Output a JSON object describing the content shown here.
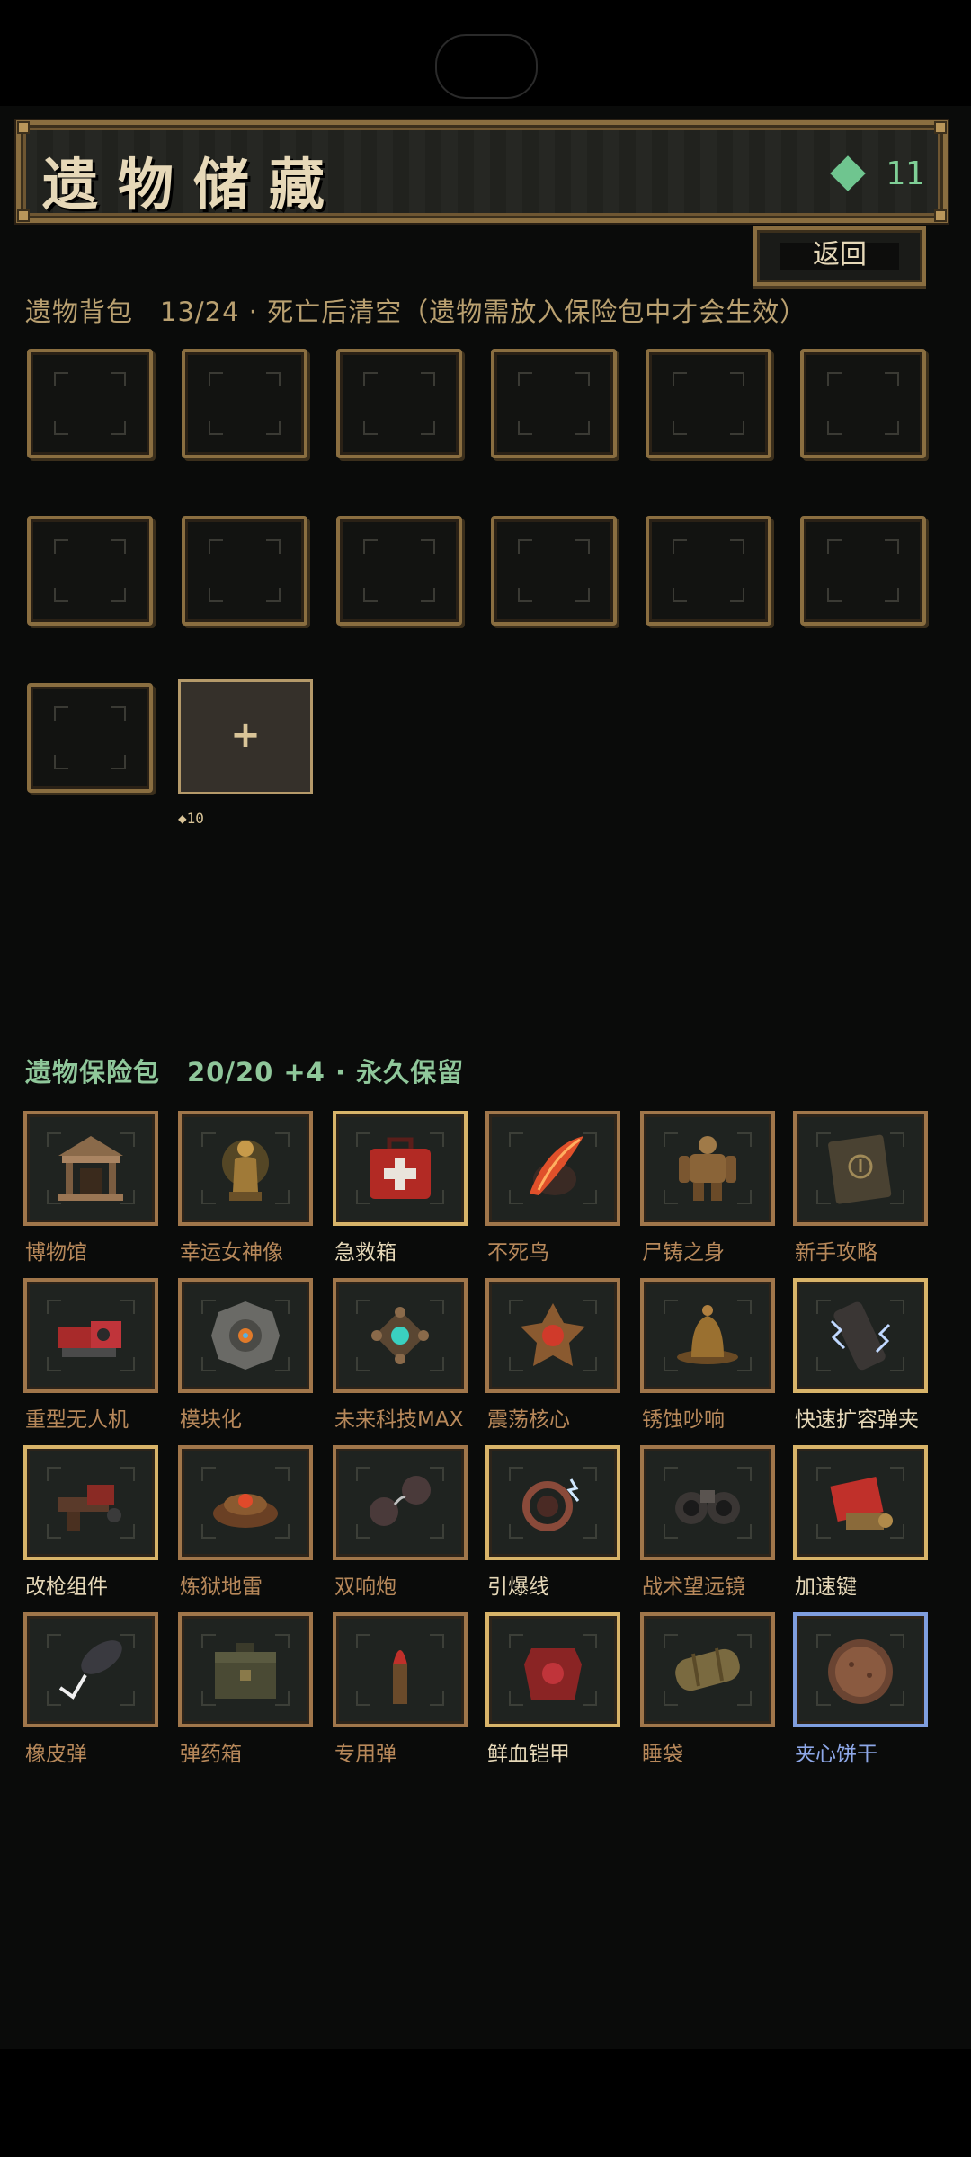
{
  "header": {
    "title": "遗物储藏",
    "gem_count": "11",
    "back_label": "返回"
  },
  "bag": {
    "title": "遗物背包　13/24 · 死亡后清空（遗物需放入保险包中才会生效）",
    "add_label": "+",
    "add_cost": "◆10"
  },
  "vault": {
    "title": "遗物保险包　20/20 +4 · 永久保留",
    "items": [
      {
        "label": "博物馆",
        "icon": "museum-icon",
        "rarity": "common"
      },
      {
        "label": "幸运女神像",
        "icon": "goddess-statue-icon",
        "rarity": "common"
      },
      {
        "label": "急救箱",
        "icon": "first-aid-kit-icon",
        "rarity": "rare"
      },
      {
        "label": "不死鸟",
        "icon": "phoenix-feather-icon",
        "rarity": "common"
      },
      {
        "label": "尸铸之身",
        "icon": "golem-body-icon",
        "rarity": "common"
      },
      {
        "label": "新手攻略",
        "icon": "guide-book-icon",
        "rarity": "common"
      },
      {
        "label": "重型无人机",
        "icon": "heavy-drone-icon",
        "rarity": "common"
      },
      {
        "label": "模块化",
        "icon": "modular-core-icon",
        "rarity": "common"
      },
      {
        "label": "未来科技MAX",
        "icon": "future-tech-icon",
        "rarity": "common"
      },
      {
        "label": "震荡核心",
        "icon": "shock-core-icon",
        "rarity": "common"
      },
      {
        "label": "锈蚀吵响",
        "icon": "rusty-bell-icon",
        "rarity": "common"
      },
      {
        "label": "快速扩容弹夹",
        "icon": "magazine-icon",
        "rarity": "rare"
      },
      {
        "label": "改枪组件",
        "icon": "gun-parts-icon",
        "rarity": "rare"
      },
      {
        "label": "炼狱地雷",
        "icon": "landmine-icon",
        "rarity": "common"
      },
      {
        "label": "双响炮",
        "icon": "double-bomb-icon",
        "rarity": "common"
      },
      {
        "label": "引爆线",
        "icon": "detonator-wire-icon",
        "rarity": "rare"
      },
      {
        "label": "战术望远镜",
        "icon": "binoculars-icon",
        "rarity": "common"
      },
      {
        "label": "加速键",
        "icon": "accelerator-key-icon",
        "rarity": "rare"
      },
      {
        "label": "橡皮弹",
        "icon": "rubber-bullet-icon",
        "rarity": "common"
      },
      {
        "label": "弹药箱",
        "icon": "ammo-box-icon",
        "rarity": "common"
      },
      {
        "label": "专用弹",
        "icon": "special-bullet-icon",
        "rarity": "common"
      },
      {
        "label": "鲜血铠甲",
        "icon": "blood-armor-icon",
        "rarity": "rare"
      },
      {
        "label": "睡袋",
        "icon": "sleeping-bag-icon",
        "rarity": "common"
      },
      {
        "label": "夹心饼干",
        "icon": "sandwich-cookie-icon",
        "rarity": "epic"
      }
    ]
  },
  "colors": {
    "background": "#0a0b0a",
    "frame_common": "#a0764a",
    "frame_rare": "#d8b469",
    "frame_epic": "#7f9ede",
    "gem": "#6fc58f",
    "vault_title": "#8fc79a"
  }
}
